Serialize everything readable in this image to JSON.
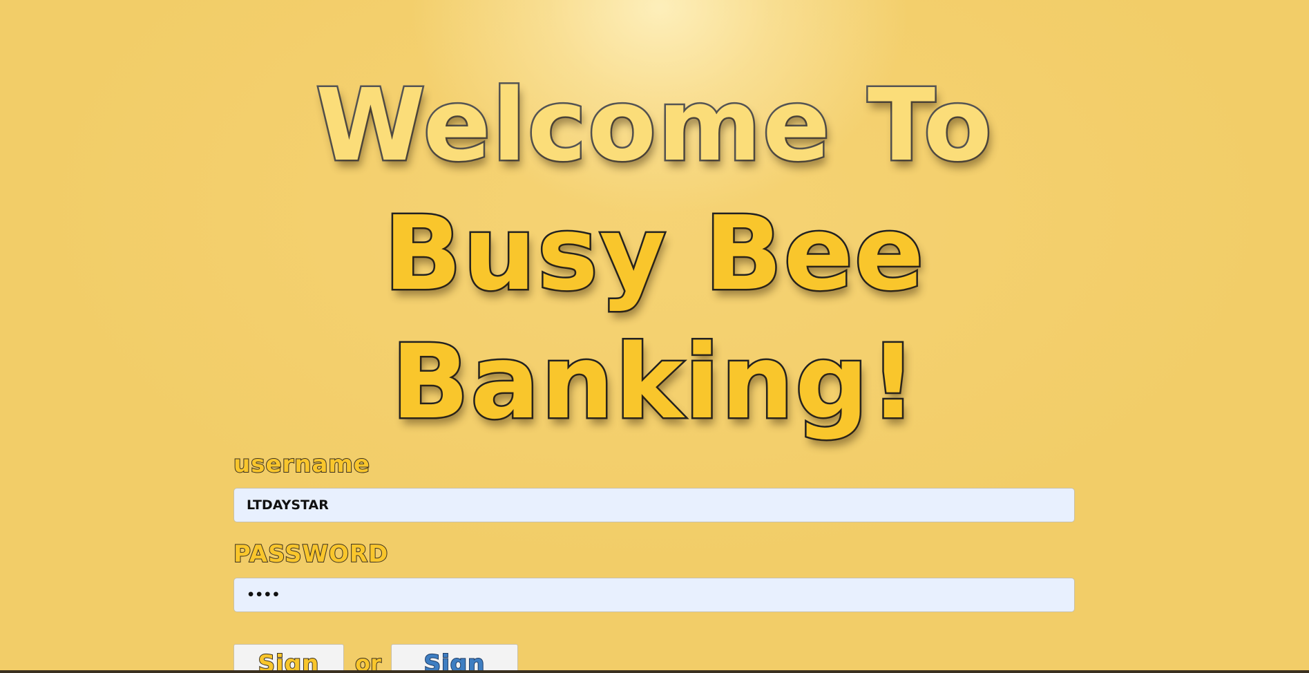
{
  "hero": {
    "line1": "Welcome To",
    "line2": "Busy Bee",
    "line3": "Banking!"
  },
  "login_form": {
    "username_label": "username",
    "username_value": "LTDAYSTAR",
    "password_label": "PASSWORD",
    "password_value": "••••",
    "signin_label": "Sign In",
    "or_text": "or",
    "signup_label": "Sign Up!"
  },
  "colors": {
    "background": "#f2cd68",
    "title_fill": "#f9c62c",
    "signup_text": "#3e7ec2",
    "input_background": "#e8f0fe"
  }
}
